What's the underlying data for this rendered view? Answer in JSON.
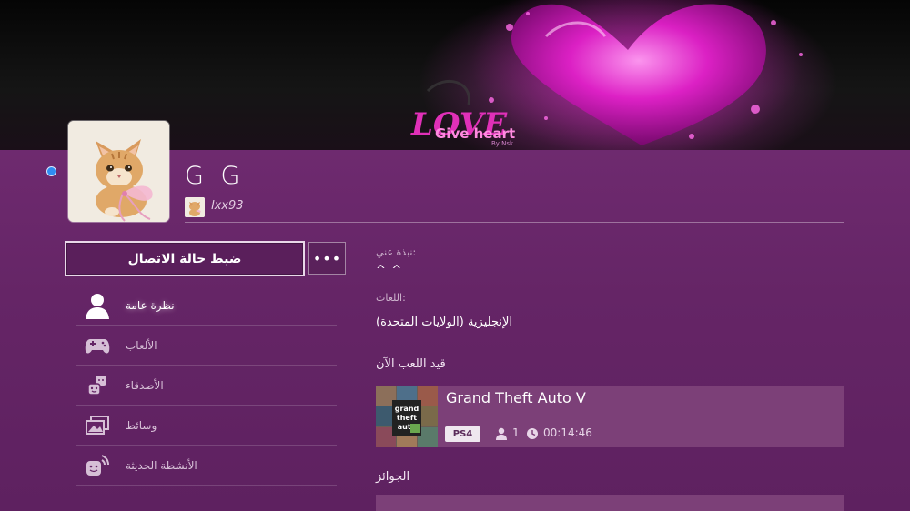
{
  "banner": {
    "art_text_1": "LOVE",
    "art_text_2": "Give heart",
    "art_text_3": "By Nsk"
  },
  "profile": {
    "online_name": "G G",
    "psn_id": "lxx93",
    "online_status_color": "#2f8cf2"
  },
  "actions": {
    "status_button_label": "ضبط حالة الاتصال",
    "more_button_label": "•••"
  },
  "nav": {
    "items": [
      {
        "label": "نظرة عامة",
        "icon": "person-icon",
        "active": true
      },
      {
        "label": "الألعاب",
        "icon": "gamepad-icon",
        "active": false
      },
      {
        "label": "الأصدقاء",
        "icon": "friends-icon",
        "active": false
      },
      {
        "label": "وسائط",
        "icon": "media-icon",
        "active": false
      },
      {
        "label": "الأنشطة الحديثة",
        "icon": "activity-icon",
        "active": false
      }
    ]
  },
  "about": {
    "about_label": "نبذة عني:",
    "about_value": "^_^",
    "languages_label": "اللغات:",
    "languages_value": "الإنجليزية (الولايات المتحدة)"
  },
  "now_playing": {
    "section_title": "قيد اللعب الآن",
    "game_title": "Grand Theft Auto V",
    "platform": "PS4",
    "player_count": "1",
    "play_time": "00:14:46",
    "thumb_text_1": "grand",
    "thumb_text_2": "theft",
    "thumb_text_3": "auto"
  },
  "trophies": {
    "section_title": "الجوائز"
  },
  "colors": {
    "background": "#652566",
    "card": "#7c4078",
    "accent_pink": "#e020c8"
  }
}
